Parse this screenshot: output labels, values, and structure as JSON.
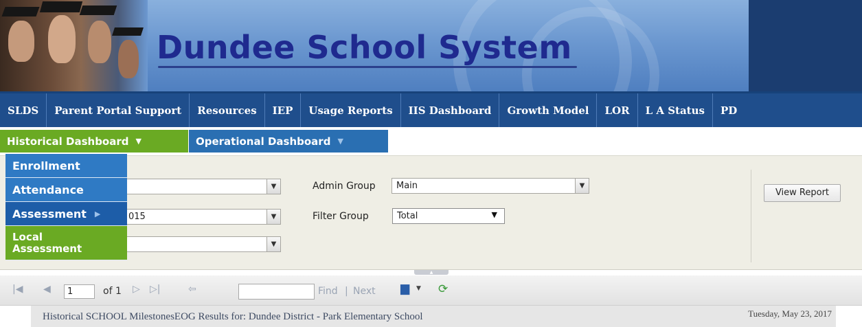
{
  "banner": {
    "title": "Dundee School System"
  },
  "topnav": {
    "items": [
      "SLDS",
      "Parent Portal Support",
      "Resources",
      "IEP",
      "Usage Reports",
      "IIS Dashboard",
      "Growth Model",
      "LOR",
      "L A Status",
      "PD"
    ]
  },
  "tabs": {
    "historical": "Historical Dashboard",
    "operational": "Operational Dashboard"
  },
  "menu": {
    "items": [
      "Enrollment",
      "Attendance",
      "Assessment",
      "Local",
      "Assessment"
    ]
  },
  "params": {
    "field2_value": "015",
    "admin_group_label": "Admin Group",
    "admin_group_value": "Main",
    "filter_group_label": "Filter Group",
    "filter_group_value": "Total",
    "view_report": "View Report"
  },
  "toolbar": {
    "page": "1",
    "of_pages": "of 1",
    "find": "Find",
    "separator": "|",
    "next": "Next"
  },
  "report": {
    "title": "Historical  SCHOOL MilestonesEOG Results for: Dundee District - Park Elementary School",
    "date": "Tuesday, May 23, 2017"
  },
  "colors": {
    "nav_blue": "#1f4e8c",
    "tab_green": "#6aaa23",
    "tab_blue": "#2a6fb2"
  }
}
